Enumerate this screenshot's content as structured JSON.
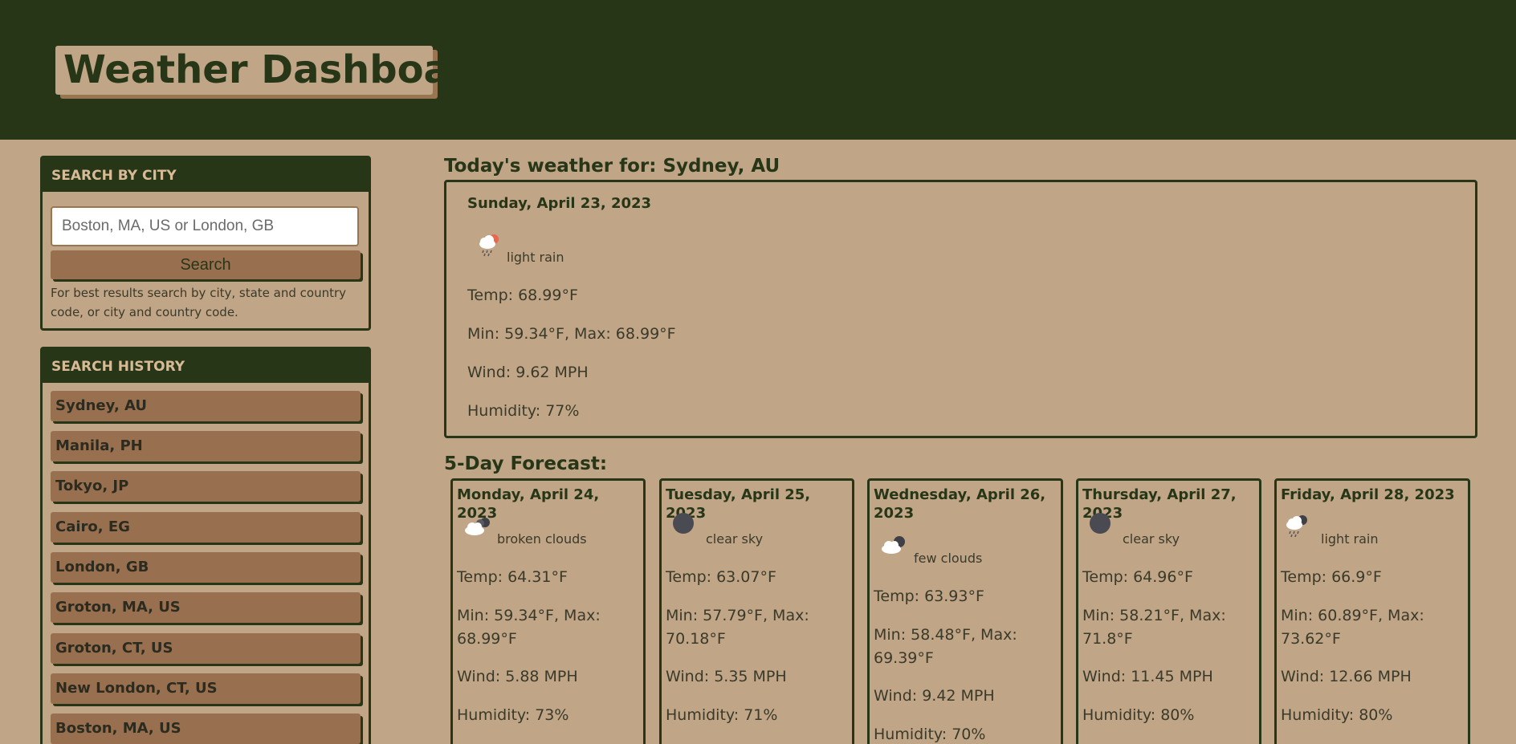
{
  "header": {
    "title": "Weather Dashboard"
  },
  "search": {
    "heading": "SEARCH BY CITY",
    "placeholder": "Boston, MA, US or London, GB",
    "button_label": "Search",
    "note": "For best results search by city, state and country code, or city and country code."
  },
  "history": {
    "heading": "SEARCH HISTORY",
    "items": [
      "Sydney, AU",
      "Manila, PH",
      "Tokyo, JP",
      "Cairo, EG",
      "London, GB",
      "Groton, MA, US",
      "Groton, CT, US",
      "New London, CT, US",
      "Boston, MA, US"
    ]
  },
  "today": {
    "heading": "Today's weather for: Sydney, AU",
    "date": "Sunday, April 23, 2023",
    "icon": "light-rain-day-icon",
    "description": "light rain",
    "temp": "Temp: 68.99°F",
    "minmax": "Min: 59.34°F, Max: 68.99°F",
    "wind": "Wind: 9.62 MPH",
    "humidity": "Humidity: 77%"
  },
  "forecast": {
    "heading": "5-Day Forecast:",
    "days": [
      {
        "date": "Monday, April 24, 2023",
        "icon": "broken-clouds-night-icon",
        "description": "broken clouds",
        "temp": "Temp: 64.31°F",
        "minmax": "Min: 59.34°F, Max: 68.99°F",
        "wind": "Wind: 5.88 MPH",
        "humidity": "Humidity: 73%"
      },
      {
        "date": "Tuesday, April 25, 2023",
        "icon": "clear-sky-night-icon",
        "description": "clear sky",
        "temp": "Temp: 63.07°F",
        "minmax": "Min: 57.79°F, Max: 70.18°F",
        "wind": "Wind: 5.35 MPH",
        "humidity": "Humidity: 71%"
      },
      {
        "date": "Wednesday, April 26, 2023",
        "icon": "few-clouds-night-icon",
        "description": "few clouds",
        "temp": "Temp: 63.93°F",
        "minmax": "Min: 58.48°F, Max: 69.39°F",
        "wind": "Wind: 9.42 MPH",
        "humidity": "Humidity: 70%"
      },
      {
        "date": "Thursday, April 27, 2023",
        "icon": "clear-sky-night-icon",
        "description": "clear sky",
        "temp": "Temp: 64.96°F",
        "minmax": "Min: 58.21°F, Max: 71.8°F",
        "wind": "Wind: 11.45 MPH",
        "humidity": "Humidity: 80%"
      },
      {
        "date": "Friday, April 28, 2023",
        "icon": "light-rain-night-icon",
        "description": "light rain",
        "temp": "Temp: 66.9°F",
        "minmax": "Min: 60.89°F, Max: 73.62°F",
        "wind": "Wind: 12.66 MPH",
        "humidity": "Humidity: 80%"
      }
    ]
  },
  "colors": {
    "dark_green": "#283618",
    "tan": "#c1a587",
    "button_brown": "#99704f"
  }
}
